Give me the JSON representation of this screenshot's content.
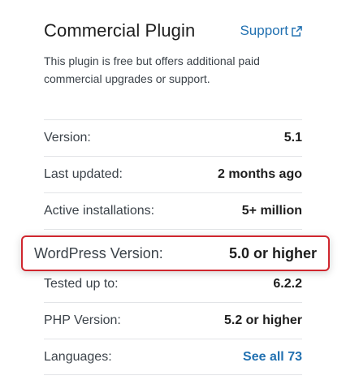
{
  "header": {
    "title": "Commercial Plugin",
    "support_label": "Support"
  },
  "description": "This plugin is free but offers additional paid commercial upgrades or support.",
  "details": {
    "version": {
      "label": "Version:",
      "value": "5.1"
    },
    "last_updated": {
      "label": "Last updated:",
      "value": "2 months ago"
    },
    "active_installations": {
      "label": "Active installations:",
      "value": "5+ million"
    },
    "wordpress_version": {
      "label": "WordPress Version:",
      "value": "5.0 or higher"
    },
    "tested_up_to": {
      "label": "Tested up to:",
      "value": "6.2.2"
    },
    "php_version": {
      "label": "PHP Version:",
      "value": "5.2 or higher"
    },
    "languages": {
      "label": "Languages:",
      "value": "See all 73"
    }
  },
  "colors": {
    "link": "#2271b1",
    "highlight_border": "#d0262e",
    "divider": "#e2e4e7"
  },
  "icons": {
    "support": "external-link-icon"
  }
}
